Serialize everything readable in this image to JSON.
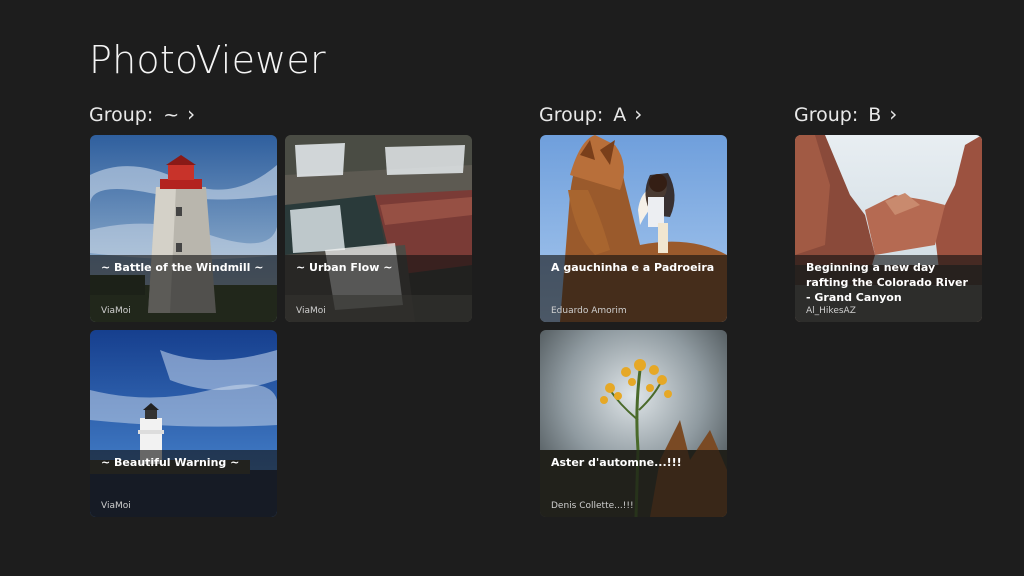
{
  "app": {
    "title": "PhotoViewer"
  },
  "groups": [
    {
      "label": "Group:",
      "key": "~",
      "chevron": "›",
      "items": [
        {
          "title": "~ Battle of the Windmill ~",
          "author": "ViaMoi",
          "image": "lighthouse-windmill"
        },
        {
          "title": "~ Urban Flow ~",
          "author": "ViaMoi",
          "image": "waterfall-rocks"
        },
        {
          "title": "~ Beautiful  Warning ~",
          "author": "ViaMoi",
          "image": "lighthouse-blue-sky"
        }
      ]
    },
    {
      "label": "Group:",
      "key": "A",
      "chevron": "›",
      "items": [
        {
          "title": "A gauchinha e a Padroeira",
          "author": "Eduardo Amorim",
          "image": "girl-on-horse"
        },
        {
          "title": "Aster d'automne...!!!",
          "author": "Denis Collette...!!!",
          "image": "yellow-wildflower"
        }
      ]
    },
    {
      "label": "Group:",
      "key": "B",
      "chevron": "›",
      "items": [
        {
          "title": "Beginning a new day rafting the Colorado River - Grand Canyon",
          "author": "Al_HikesAZ",
          "image": "grand-canyon-river"
        }
      ]
    }
  ],
  "colors": {
    "background": "#1d1d1d",
    "text": "#ffffff",
    "overlay": "#121212"
  }
}
